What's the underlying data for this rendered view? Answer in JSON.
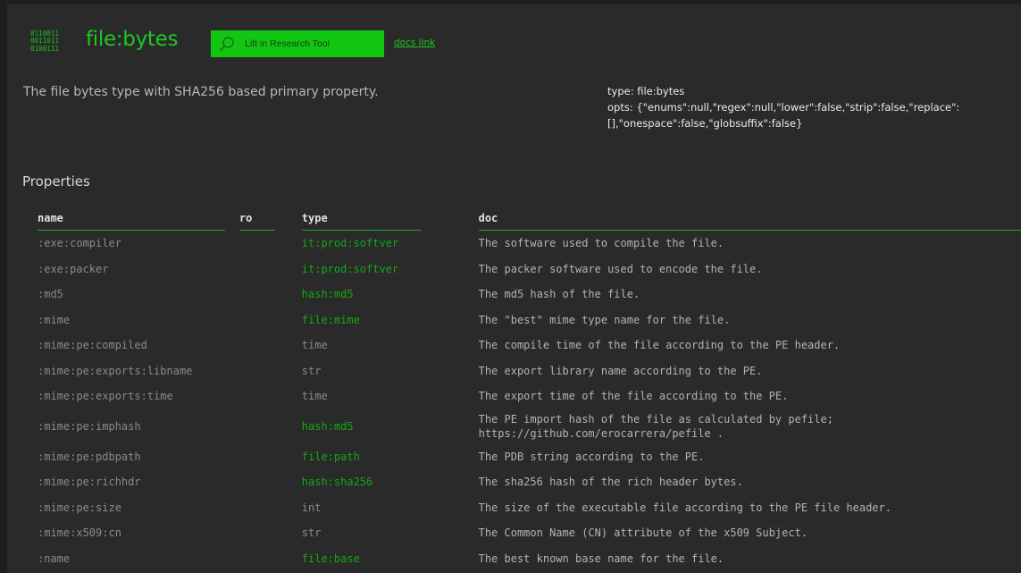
{
  "header": {
    "logo_bits": "0110011\n0011011\n0100111",
    "title": "file:bytes",
    "lift_button_label": "Lift in Research Tool",
    "docs_link": "docs link"
  },
  "description": "The file bytes type with SHA256 based primary property.",
  "meta": {
    "type_line": "type: file:bytes",
    "opts_line": "opts: {\"enums\":null,\"regex\":null,\"lower\":false,\"strip\":false,\"replace\": [],\"onespace\":false,\"globsuffix\":false}"
  },
  "properties": {
    "title": "Properties",
    "columns": {
      "name": "name",
      "ro": "ro",
      "type": "type",
      "doc": "doc"
    },
    "rows": [
      {
        "name": ":exe:compiler",
        "ro": "",
        "type": "it:prod:softver",
        "type_linked": true,
        "doc": "The software used to compile the file."
      },
      {
        "name": ":exe:packer",
        "ro": "",
        "type": "it:prod:softver",
        "type_linked": true,
        "doc": "The packer software used to encode the file."
      },
      {
        "name": ":md5",
        "ro": "",
        "type": "hash:md5",
        "type_linked": true,
        "doc": "The md5 hash of the file."
      },
      {
        "name": ":mime",
        "ro": "",
        "type": "file:mime",
        "type_linked": true,
        "doc": "The \"best\" mime type name for the file."
      },
      {
        "name": ":mime:pe:compiled",
        "ro": "",
        "type": "time",
        "type_linked": false,
        "doc": "The compile time of the file according to the PE header."
      },
      {
        "name": ":mime:pe:exports:libname",
        "ro": "",
        "type": "str",
        "type_linked": false,
        "doc": "The export library name according to the PE."
      },
      {
        "name": ":mime:pe:exports:time",
        "ro": "",
        "type": "time",
        "type_linked": false,
        "doc": "The export time of the file according to the PE."
      },
      {
        "name": ":mime:pe:imphash",
        "ro": "",
        "type": "hash:md5",
        "type_linked": true,
        "doc": "The PE import hash of the file as calculated by pefile; https://github.com/erocarrera/pefile .",
        "tall": true
      },
      {
        "name": ":mime:pe:pdbpath",
        "ro": "",
        "type": "file:path",
        "type_linked": true,
        "doc": "The PDB string according to the PE."
      },
      {
        "name": ":mime:pe:richhdr",
        "ro": "",
        "type": "hash:sha256",
        "type_linked": true,
        "doc": "The sha256 hash of the rich header bytes."
      },
      {
        "name": ":mime:pe:size",
        "ro": "",
        "type": "int",
        "type_linked": false,
        "doc": "The size of the executable file according to the PE file header."
      },
      {
        "name": ":mime:x509:cn",
        "ro": "",
        "type": "str",
        "type_linked": false,
        "doc": "The Common Name (CN) attribute of the x509 Subject."
      },
      {
        "name": ":name",
        "ro": "",
        "type": "file:base",
        "type_linked": true,
        "doc": "The best known base name for the file."
      }
    ]
  },
  "colors": {
    "accent": "#1ec81e",
    "background": "#2a2a2a",
    "link_type": "#13a813",
    "muted_text": "#8a8a8a"
  },
  "icons": {
    "lift_button": "search-icon"
  }
}
